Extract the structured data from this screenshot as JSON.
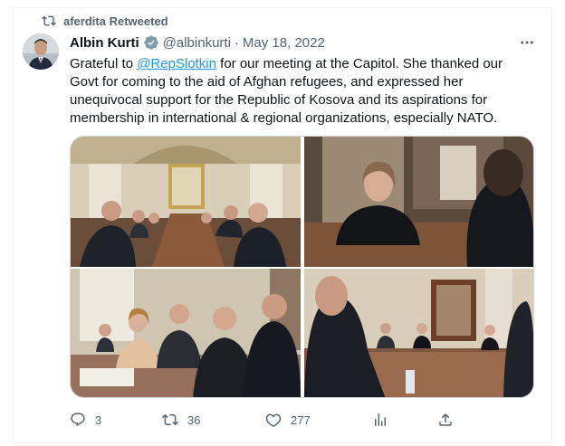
{
  "retweet": {
    "label": "aferdita Retweeted",
    "icon": "retweet-icon"
  },
  "author": {
    "name": "Albin Kurti",
    "handle": "@albinkurti",
    "separator": "·",
    "date": "May 18, 2022",
    "verified_icon": "verified-badge-icon"
  },
  "tweet": {
    "text_before_mention": "Grateful to ",
    "mention": "@RepSlotkin",
    "text_after_mention": " for our meeting at the Capitol. She thanked our Govt for coming to the aid of Afghan refugees, and expressed her unequivocal support for the Republic of Kosova and its aspirations for membership in international & regional organizations, especially NATO."
  },
  "media": {
    "photos": [
      "meeting-photo-1",
      "meeting-photo-2",
      "meeting-photo-3",
      "meeting-photo-4"
    ]
  },
  "actions": {
    "replies": "3",
    "retweets": "36",
    "likes": "277"
  },
  "colors": {
    "accent": "#1d9bf0",
    "muted": "#536471",
    "text": "#0f1419"
  }
}
